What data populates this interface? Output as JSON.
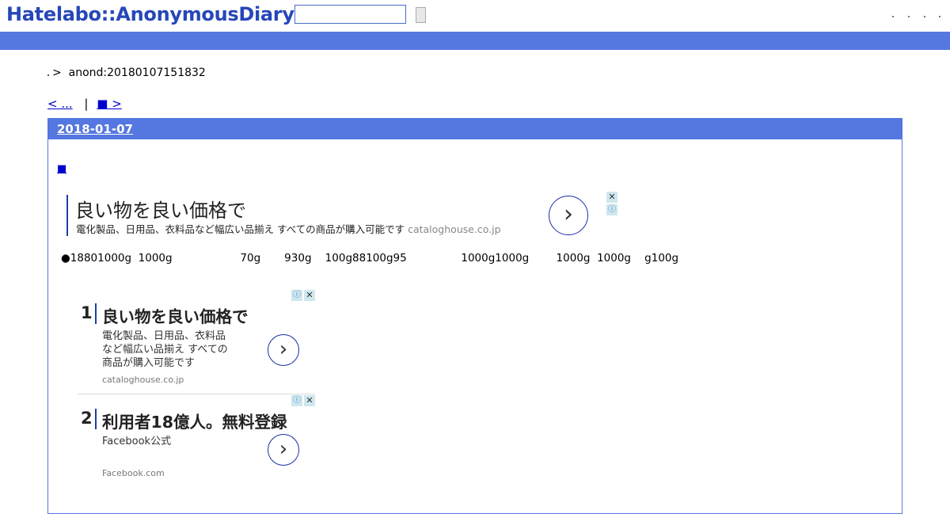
{
  "header": {
    "logo": "Hatelabo::AnonymousDiary",
    "search_placeholder": "",
    "search_button_label": ""
  },
  "breadcrumb": {
    "separator": ">",
    "current": "anond:20180107151832"
  },
  "pager": {
    "prev_label": "< ...",
    "separator": "|",
    "next_label": "■ >"
  },
  "day": {
    "date": "2018-01-07",
    "section_link": "■",
    "body_text": "●18801000g  1000g                    70g       930g    100g88100g95                1000g1000g        1000g  1000g    g100g"
  },
  "ad_banner": {
    "title": "良い物を良い価格で",
    "description": "電化製品、日用品、衣料品など幅広い品揃え すべての商品が購入可能です",
    "domain": "cataloghouse.co.jp"
  },
  "ad_list": [
    {
      "number": "1",
      "title": "良い物を良い価格で",
      "description_lines": [
        "電化製品、日用品、衣料品",
        "など幅広い品揃え すべての",
        "商品が購入可能です"
      ],
      "domain": "cataloghouse.co.jp"
    },
    {
      "number": "2",
      "title": "利用者18億人。無料登録",
      "description_lines": [
        "Facebook公式"
      ],
      "domain": "Facebook.com"
    }
  ],
  "ad_controls": {
    "close_glyph": "✕",
    "info_glyph": "ⓘ",
    "arrow_glyph": "›"
  },
  "colors": {
    "brand_blue": "#2647b8",
    "bar_blue": "#5577e0",
    "link_blue": "#0000cc"
  }
}
